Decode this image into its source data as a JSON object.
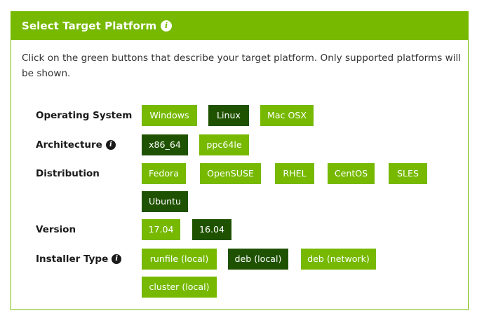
{
  "header": {
    "title": "Select Target Platform",
    "info_icon": "info-icon"
  },
  "intro": "Click on the green buttons that describe your target platform. Only supported platforms will be shown.",
  "colors": {
    "accent": "#76b900",
    "selected": "#1f5200"
  },
  "rows": {
    "os": {
      "label": "Operating System",
      "options": [
        "Windows",
        "Linux",
        "Mac OSX"
      ],
      "selected": "Linux"
    },
    "arch": {
      "label": "Architecture",
      "options": [
        "x86_64",
        "ppc64le"
      ],
      "selected": "x86_64"
    },
    "distro": {
      "label": "Distribution",
      "options": [
        "Fedora",
        "OpenSUSE",
        "RHEL",
        "CentOS",
        "SLES",
        "Ubuntu"
      ],
      "selected": "Ubuntu"
    },
    "version": {
      "label": "Version",
      "options": [
        "17.04",
        "16.04"
      ],
      "selected": "16.04"
    },
    "installer": {
      "label": "Installer Type",
      "options": [
        "runfile (local)",
        "deb (local)",
        "deb (network)",
        "cluster (local)"
      ],
      "selected": "deb (local)"
    }
  }
}
